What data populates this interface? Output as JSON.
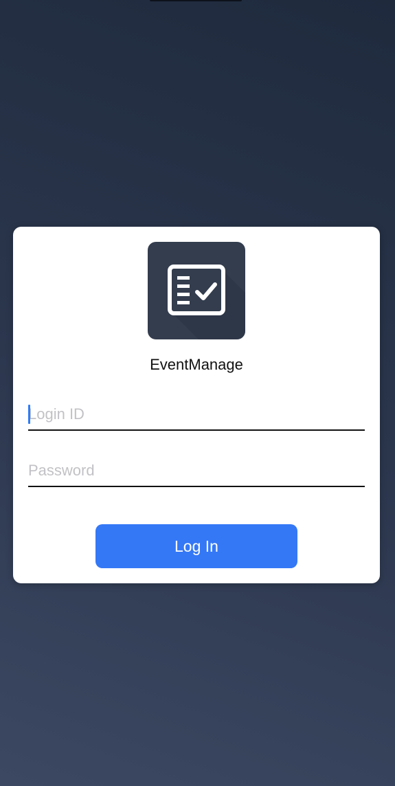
{
  "app": {
    "name": "EventManage",
    "icon": "checklist-icon"
  },
  "form": {
    "login_id": {
      "value": "",
      "placeholder": "Login ID"
    },
    "password": {
      "value": "",
      "placeholder": "Password"
    },
    "submit_label": "Log In"
  },
  "colors": {
    "background": "#2b364d",
    "card": "#ffffff",
    "icon_background": "#333d4e",
    "accent": "#3478f6",
    "caret": "#2f7cf6"
  }
}
